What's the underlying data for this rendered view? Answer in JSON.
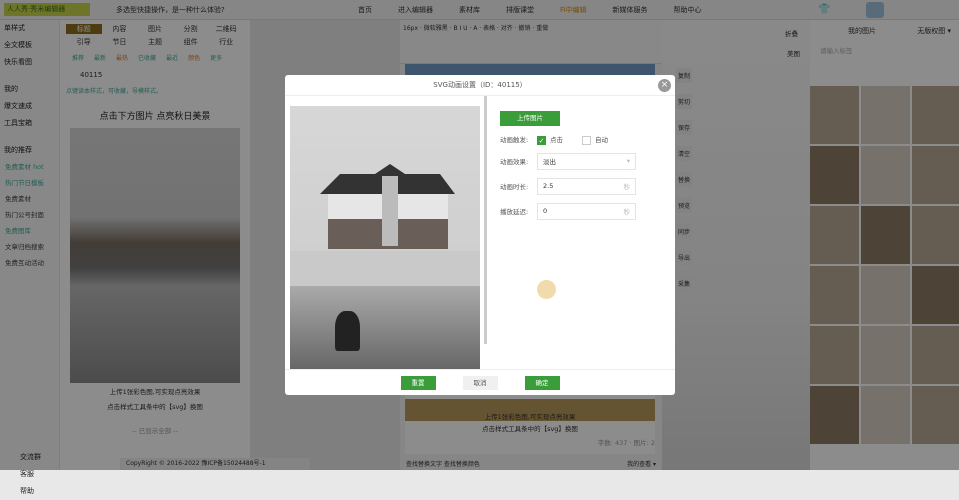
{
  "header": {
    "logo": "人人秀·秀米编辑器",
    "notice": "多选型快捷操作，是一种什么体验?",
    "nav": [
      "首页",
      "进入编辑器",
      "素材库",
      "排版课堂",
      "Fi中编辑",
      "新媒体服务",
      "帮助中心"
    ]
  },
  "sidebar": {
    "items": [
      "单样式",
      "全文模板",
      "快乐看图",
      "我的",
      "爆文速成",
      "工具宝箱",
      "我的推荐"
    ],
    "subs": [
      "免费素材 hot",
      "热门节日模板",
      "免费素材",
      "热门公号封面",
      "免费图库",
      "文章归档搜索",
      "免费互动活动"
    ],
    "bottom": [
      "交流群",
      "客服",
      "帮助"
    ]
  },
  "panel": {
    "tabs": [
      "标题",
      "内容",
      "图片",
      "分割",
      "二维码",
      "引导",
      "节日",
      "主题",
      "组件",
      "行业"
    ],
    "filters": [
      "推荐",
      "最新",
      "最热",
      "已收藏",
      "最近",
      "颜色",
      "更多"
    ],
    "search_value": "40115",
    "tip": "点键读本样式，可收藏，导模样式。",
    "card_title": "点击下方图片  点亮秋日美景",
    "caption1": "上传1张彩色图,可实现点亮效果",
    "caption2": "点击样式工具条中的【svg】换图",
    "more": "-- 已显示全部 --",
    "copyright": "CopyRight © 2016-2022 豫ICP备15024488号-1"
  },
  "editor": {
    "toolbar": "16px · 微软雅黑 · B I U · A · 表格 · 对齐 · 撤销 · 重做",
    "caption1": "上传1张彩色图,可实现点亮效果",
    "caption2": "点击样式工具条中的【svg】换图",
    "stats": "字数: 437 · 图片: 2",
    "footer_left": "查找替换文字  查找替换颜色",
    "footer_right": "我的查看 ▾"
  },
  "tools": [
    "复制",
    "剪切",
    "保存",
    "清空",
    "替换",
    "预览",
    "同步",
    "导出",
    "采集"
  ],
  "right_panel": {
    "collapse": "折叠",
    "draw": "美图",
    "tab_images": "我的图片",
    "tab_free": "无版权图 ▾",
    "search_placeholder": "请输入标签"
  },
  "modal": {
    "title": "SVG动画设置（ID：40115）",
    "upload": "上传图片",
    "trigger_label": "动画触发:",
    "trigger_options": [
      "点击",
      "自动"
    ],
    "trigger_selected": "点击",
    "effect_label": "动画效果:",
    "effect_value": "淡出",
    "duration_label": "动画时长:",
    "duration_value": "2.5",
    "delay_label": "播放延迟:",
    "delay_value": "0",
    "unit": "秒",
    "buttons": {
      "reset": "重置",
      "cancel": "取消",
      "confirm": "确定"
    }
  },
  "colors": {
    "accent": "#3a9d3a",
    "overlay": "rgba(0,0,0,0.45)"
  }
}
